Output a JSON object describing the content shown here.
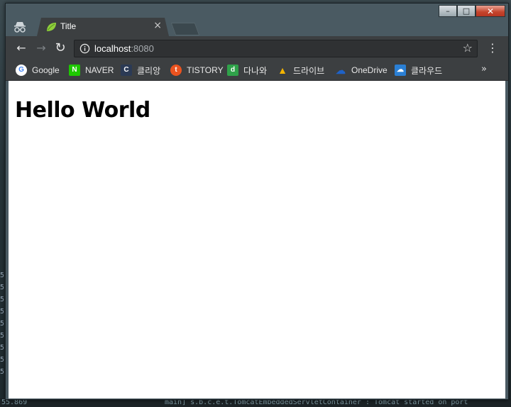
{
  "window": {
    "minimize": "–",
    "maximize": "□",
    "close": "✕"
  },
  "tab": {
    "title": "Title",
    "close": "×"
  },
  "toolbar": {
    "back": "←",
    "forward": "→",
    "reload": "↻",
    "url_host": "localhost",
    "url_port": ":8080",
    "star": "☆",
    "menu": "⋮"
  },
  "bookmarks": {
    "items": [
      {
        "label": "Google",
        "icon": "G",
        "color": "#ffffff"
      },
      {
        "label": "NAVER",
        "icon": "N",
        "color": "#1ec800"
      },
      {
        "label": "클리앙",
        "icon": "C",
        "color": "#2b3a55"
      },
      {
        "label": "TISTORY",
        "icon": "t",
        "color": "#eb531f"
      },
      {
        "label": "다나와",
        "icon": "d",
        "color": "#2fa24a"
      },
      {
        "label": "드라이브",
        "icon": "▲",
        "color": "#f4b400"
      },
      {
        "label": "OneDrive",
        "icon": "☁",
        "color": "#0f4fb0"
      },
      {
        "label": "클라우드",
        "icon": "☁",
        "color": "#2a7fd4"
      }
    ],
    "more": "»"
  },
  "page": {
    "heading": "Hello World"
  },
  "terminal": {
    "left_line": "55.869",
    "mid_text": "main] s.b.c.e.t.TomcatEmbeddedServletContainer : Tomcat started on port"
  }
}
